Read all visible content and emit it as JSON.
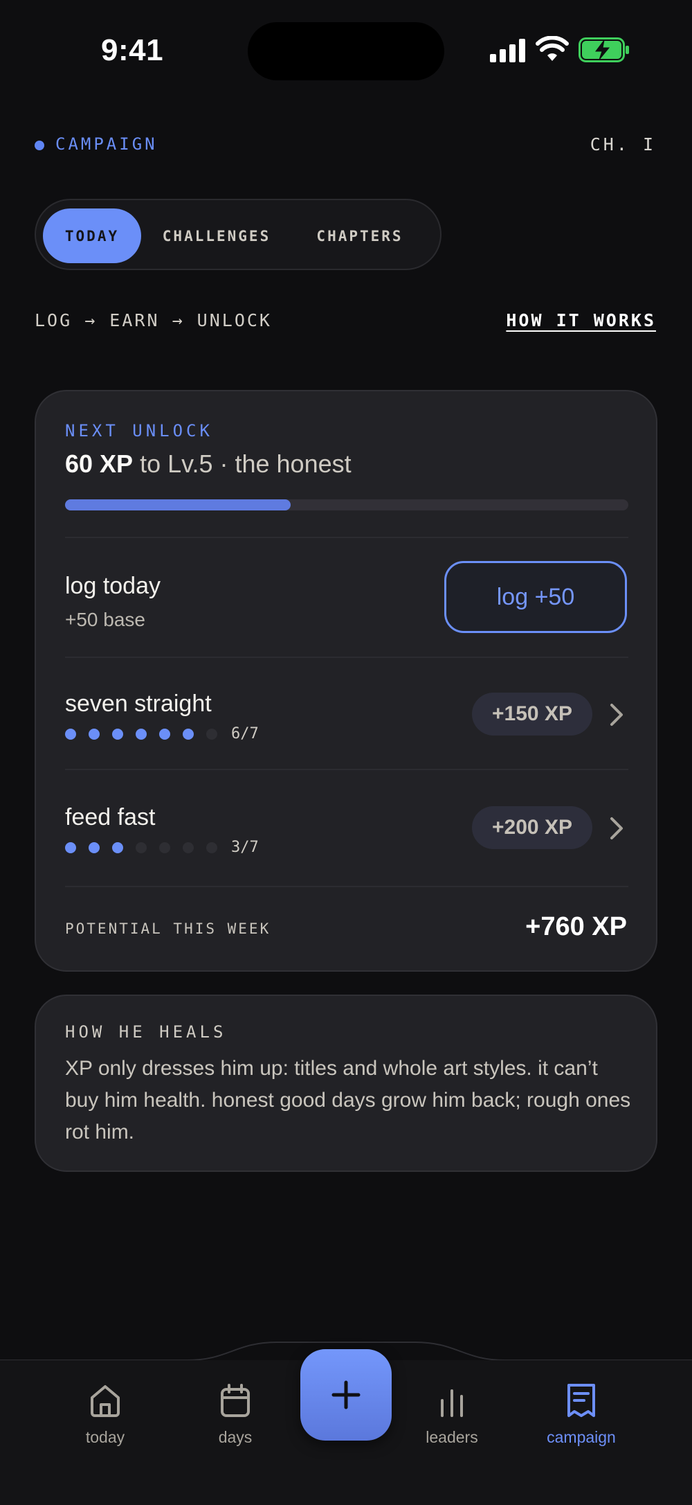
{
  "status": {
    "time": "9:41"
  },
  "header": {
    "section": "CAMPAIGN",
    "chapter": "CH. I"
  },
  "tabs": [
    {
      "label": "TODAY",
      "active": true
    },
    {
      "label": "CHALLENGES",
      "active": false
    },
    {
      "label": "CHAPTERS",
      "active": false
    }
  ],
  "flow": {
    "text": "LOG → EARN → UNLOCK",
    "link": "HOW IT WORKS"
  },
  "next_unlock": {
    "eyebrow": "NEXT UNLOCK",
    "xp_needed": "60 XP",
    "target": "to Lv.5 · the honest",
    "progress": 0.4
  },
  "log_today": {
    "title": "log today",
    "subtitle": "+50 base",
    "button": "log +50"
  },
  "challenges": [
    {
      "title": "seven straight",
      "done": 6,
      "total": 7,
      "count": "6/7",
      "reward": "+150 XP"
    },
    {
      "title": "feed fast",
      "done": 3,
      "total": 7,
      "count": "3/7",
      "reward": "+200 XP"
    }
  ],
  "potential": {
    "label": "POTENTIAL THIS WEEK",
    "value": "+760 XP"
  },
  "heals": {
    "eyebrow": "HOW HE HEALS",
    "body": "XP only dresses him up: titles and whole art styles. it can’t buy him health. honest good days grow him back; rough ones rot him."
  },
  "nav": [
    {
      "label": "today",
      "icon": "home-icon",
      "active": false
    },
    {
      "label": "days",
      "icon": "calendar-icon",
      "active": false
    },
    {
      "label": "leaders",
      "icon": "bars-icon",
      "active": false
    },
    {
      "label": "campaign",
      "icon": "scroll-icon",
      "active": true
    }
  ],
  "colors": {
    "accent": "#6b8ff8",
    "background": "#0e0e10",
    "card": "#222226"
  }
}
